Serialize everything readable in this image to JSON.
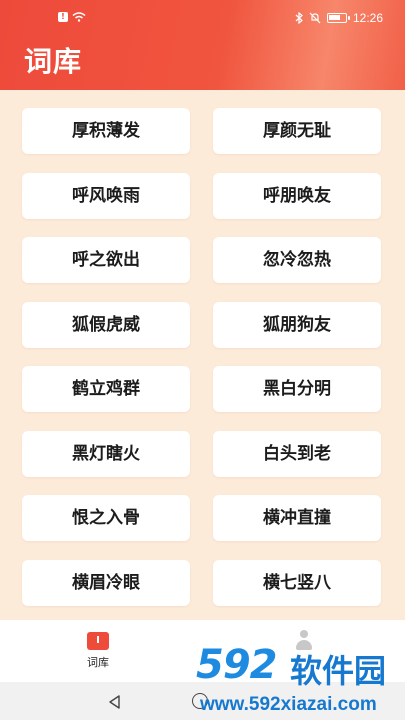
{
  "status_bar": {
    "time": "12:26",
    "battery_level": 0.7
  },
  "header": {
    "title": "词库"
  },
  "words": [
    "厚积薄发",
    "厚颜无耻",
    "呼风唤雨",
    "呼朋唤友",
    "呼之欲出",
    "忽冷忽热",
    "狐假虎威",
    "狐朋狗友",
    "鹤立鸡群",
    "黑白分明",
    "黑灯瞎火",
    "白头到老",
    "恨之入骨",
    "横冲直撞",
    "横眉冷眼",
    "横七竖八"
  ],
  "tabs": [
    {
      "label": "词库",
      "icon": "book-icon",
      "active": true
    },
    {
      "label": "",
      "icon": "user-icon",
      "active": false
    }
  ],
  "watermark": {
    "logo": "592",
    "brand": "软件园",
    "url": "www.592xiazai.com"
  },
  "colors": {
    "accent": "#ee4b3b",
    "background": "#fdebd9"
  }
}
